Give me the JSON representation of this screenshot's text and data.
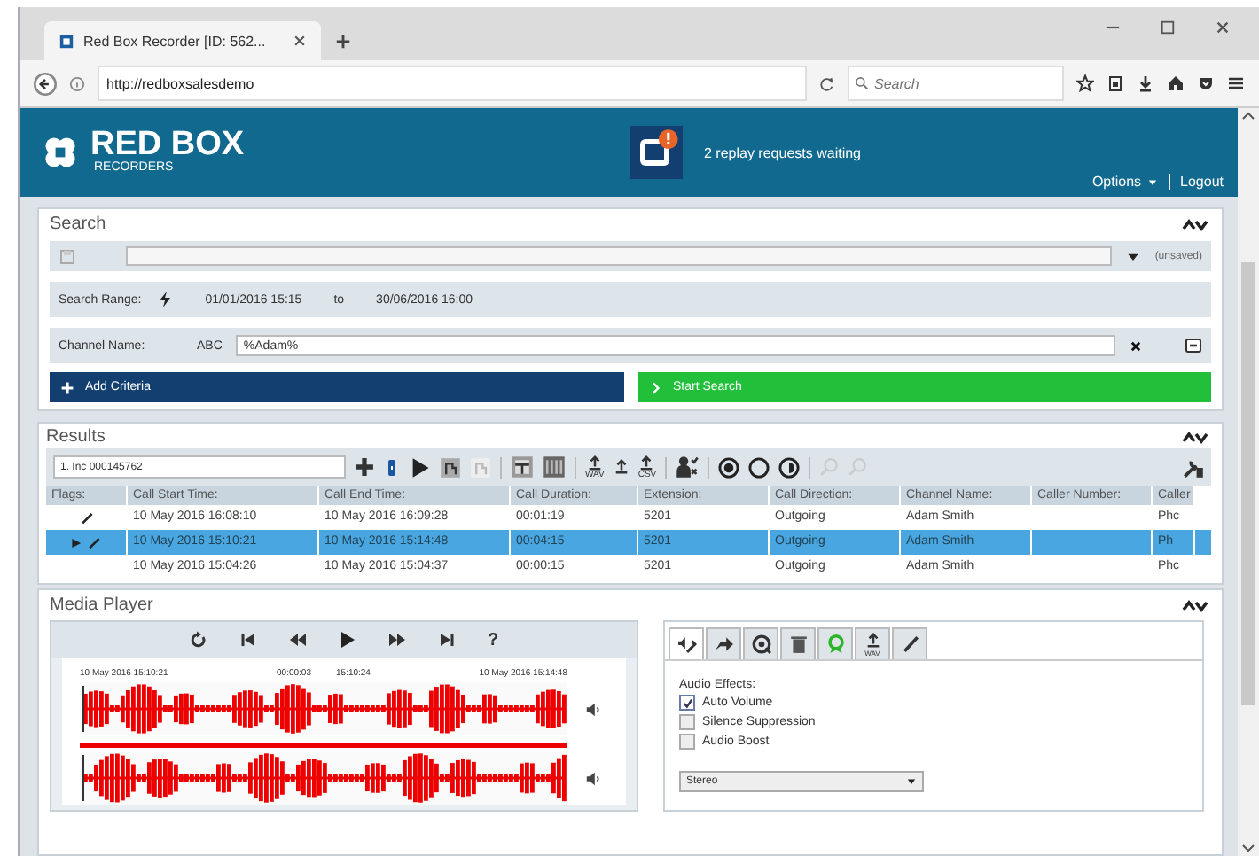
{
  "browser": {
    "tab_title": "Red Box Recorder [ID: 562...",
    "url": "http://redboxsalesdemo",
    "search_placeholder": "Search"
  },
  "header": {
    "logo_title": "RED BOX",
    "logo_subtitle": "RECORDERS",
    "notification": "2 replay requests waiting",
    "menu": [
      {
        "label": "Options",
        "kind": "dropdown"
      },
      {
        "label": "Logout",
        "kind": "link"
      }
    ]
  },
  "search": {
    "title": "Search",
    "status": "(unsaved)",
    "range": {
      "label": "Search Range:",
      "from": "01/01/2016 15:15",
      "to_label": "to",
      "to": "30/06/2016 16:00"
    },
    "criteria": [
      {
        "label": "Channel Name:",
        "type_label": "ABC",
        "value": "%Adam%"
      }
    ],
    "buttons": [
      {
        "label": "Add Criteria",
        "kind": "add"
      },
      {
        "label": "Start Search",
        "kind": "start"
      }
    ]
  },
  "results": {
    "title": "Results",
    "selector": "1. Inc 000145762",
    "exports": [
      {
        "kind": "labeled",
        "label": "WAV"
      },
      {
        "kind": "plain"
      },
      {
        "kind": "labeled",
        "label": "CSV"
      }
    ],
    "columns": [
      "Flags:",
      "Call Start Time:",
      "Call End Time:",
      "Call Duration:",
      "Extension:",
      "Call Direction:",
      "Channel Name:",
      "Caller Number:",
      "Caller"
    ],
    "rows": [
      {
        "selected": false,
        "playing": false,
        "edited": true,
        "start": "10 May 2016 16:08:10",
        "end": "10 May 2016 16:09:28",
        "duration": "00:01:19",
        "extension": "5201",
        "direction": "Outgoing",
        "channel": "Adam Smith",
        "caller": "Phc"
      },
      {
        "selected": true,
        "playing": true,
        "edited": true,
        "start": "10 May 2016 15:10:21",
        "end": "10 May 2016 15:14:48",
        "duration": "00:04:15",
        "extension": "5201",
        "direction": "Outgoing",
        "channel": "Adam Smith",
        "caller": "Ph"
      },
      {
        "selected": false,
        "playing": false,
        "edited": false,
        "start": "10 May 2016 15:04:26",
        "end": "10 May 2016 15:04:37",
        "duration": "00:00:15",
        "extension": "5201",
        "direction": "Outgoing",
        "channel": "Adam Smith",
        "caller": "Phc"
      }
    ]
  },
  "media": {
    "title": "Media Player",
    "help": "?",
    "timeline": {
      "start": "10 May 2016 15:10:21",
      "offset": "00:00:03",
      "cursor": "15:10:24",
      "end": "10 May 2016 15:14:48"
    },
    "tabs": [
      {
        "kind": "audio",
        "selected": true
      },
      {
        "kind": "forward",
        "selected": false
      },
      {
        "kind": "comment",
        "selected": false
      },
      {
        "kind": "delete",
        "selected": false
      },
      {
        "kind": "award",
        "selected": false
      },
      {
        "kind": "export",
        "label": "WAV",
        "selected": false
      },
      {
        "kind": "edit",
        "selected": false
      }
    ],
    "effects_title": "Audio Effects:",
    "effects": [
      {
        "label": "Auto Volume",
        "checked": true
      },
      {
        "label": "Silence Suppression",
        "checked": false
      },
      {
        "label": "Audio Boost",
        "checked": false
      }
    ],
    "channel_mode": "Stereo"
  }
}
